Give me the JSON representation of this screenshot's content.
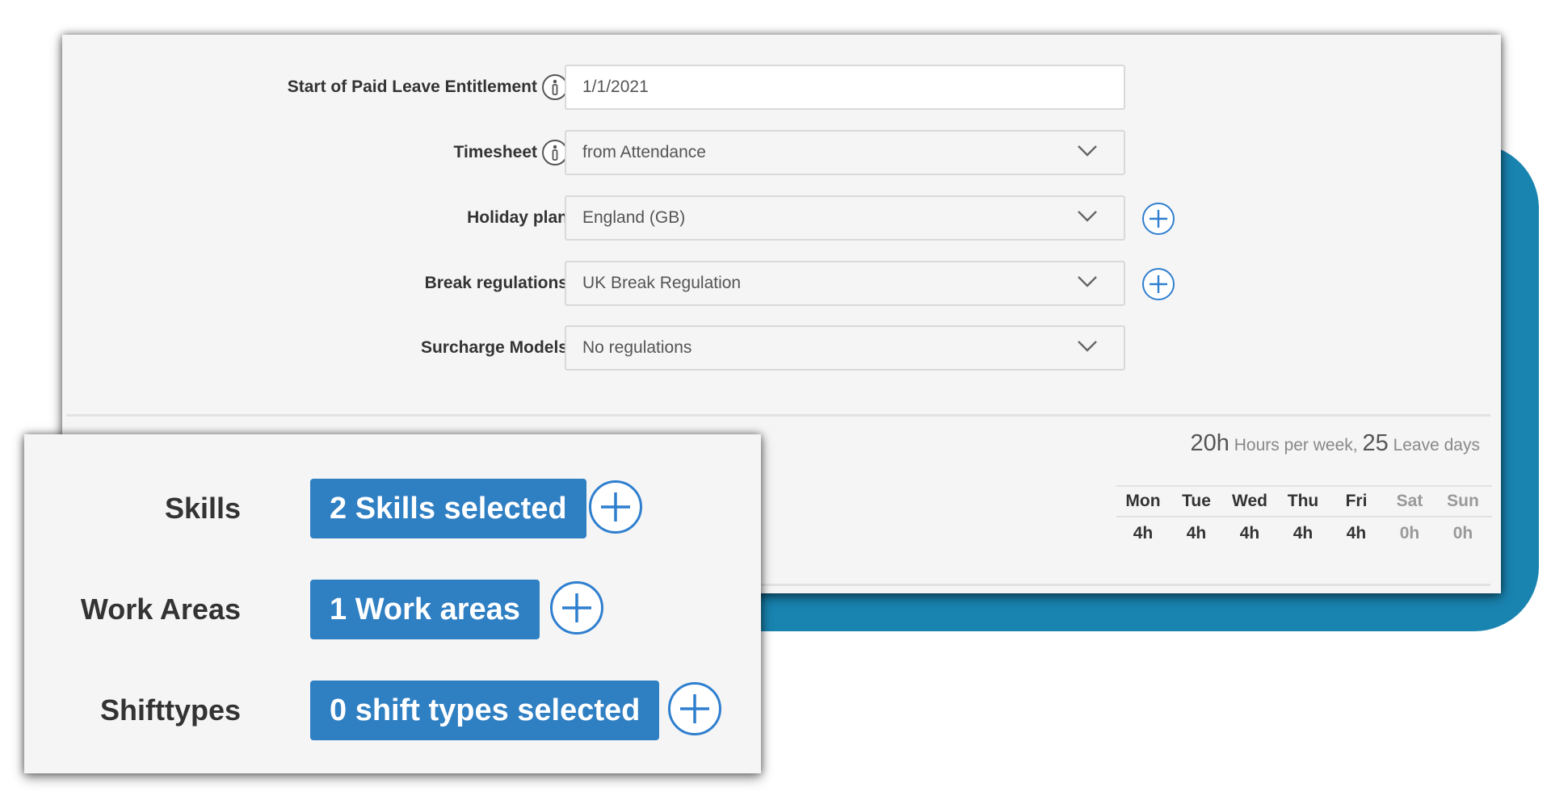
{
  "form": {
    "paid_leave": {
      "label": "Start of Paid Leave Entitlement",
      "value": "1/1/2021"
    },
    "timesheet": {
      "label": "Timesheet",
      "value": "from Attendance"
    },
    "holiday_plan": {
      "label": "Holiday plan",
      "value": "England (GB)"
    },
    "break_regulations": {
      "label": "Break regulations",
      "value": "UK Break Regulation"
    },
    "surcharge_models": {
      "label": "Surcharge Models",
      "value": "No regulations"
    }
  },
  "summary": {
    "hours_value": "20h",
    "hours_text": "Hours per week,",
    "leave_value": "25",
    "leave_text": "Leave days"
  },
  "week": {
    "days": [
      "Mon",
      "Tue",
      "Wed",
      "Thu",
      "Fri",
      "Sat",
      "Sun"
    ],
    "hours": [
      "4h",
      "4h",
      "4h",
      "4h",
      "4h",
      "0h",
      "0h"
    ]
  },
  "skills_panel": {
    "skills": {
      "label": "Skills",
      "button": "2 Skills selected"
    },
    "work_areas": {
      "label": "Work Areas",
      "button": "1 Work areas"
    },
    "shifttypes": {
      "label": "Shifttypes",
      "button": "0 shift types selected"
    }
  },
  "colors": {
    "accent": "#2f7fc3",
    "teal_backdrop": "#1a84b1",
    "panel_bg": "#f5f5f5"
  },
  "icons": {
    "info": "info-icon",
    "dropdown": "chevron-down-icon",
    "add": "plus-circle-icon"
  }
}
